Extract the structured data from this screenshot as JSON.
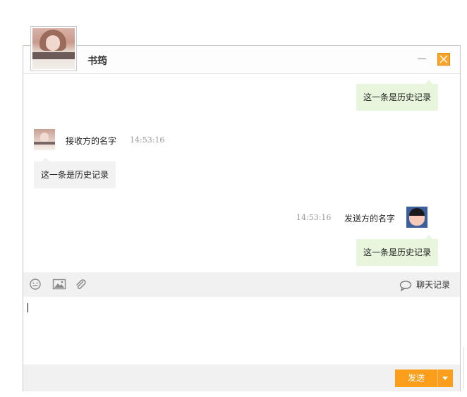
{
  "window": {
    "title": "书筠",
    "minimize_icon": "minimize-icon",
    "close_icon": "close-icon",
    "accent_color": "#f7a427"
  },
  "messages": [
    {
      "side": "right",
      "text": "这一条是历史记录"
    },
    {
      "side": "left",
      "sender": "接收方的名字",
      "time": "14:53:16",
      "text": "这一条是历史记录"
    },
    {
      "side": "right",
      "sender": "发送方的名字",
      "time": "14:53:16",
      "text": "这一条是历史记录"
    }
  ],
  "toolbar": {
    "icons": [
      "emoji-icon",
      "image-icon",
      "attachment-icon"
    ],
    "history_icon": "chat-bubble-icon",
    "history_label": "聊天记录"
  },
  "input": {
    "value": "",
    "placeholder": ""
  },
  "footer": {
    "send_label": "发送",
    "send_color": "#fa9e1b"
  }
}
